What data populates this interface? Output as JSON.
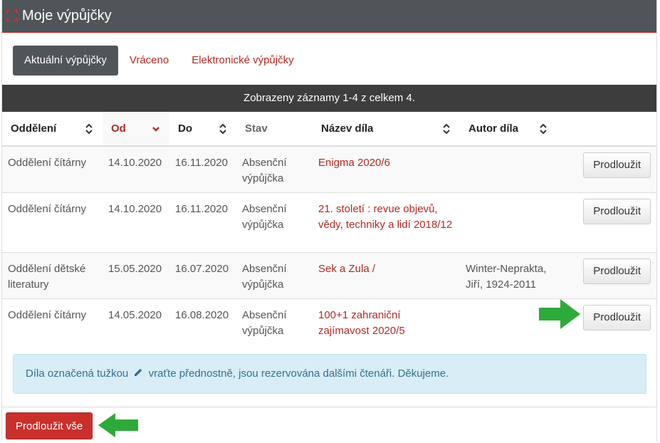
{
  "header": {
    "title": "Moje výpůjčky",
    "icon": "expand-icon"
  },
  "tabs": [
    {
      "label": "Aktuální výpůjčky",
      "active": true
    },
    {
      "label": "Vráceno",
      "active": false
    },
    {
      "label": "Elektronické výpůjčky",
      "active": false
    }
  ],
  "summary": "Zobrazeny záznamy 1-4 z celkem 4.",
  "table": {
    "columns": [
      "Oddělení",
      "Od",
      "Do",
      "Stav",
      "Název díla",
      "Autor díla"
    ],
    "rows": [
      {
        "department": "Oddělení čítárny",
        "from": "14.10.2020",
        "to": "16.11.2020",
        "status": "Absenční výpůjčka",
        "title": "Enigma 2020/6",
        "author": "",
        "action": "Prodloužit"
      },
      {
        "department": "Oddělení čítárny",
        "from": "14.10.2020",
        "to": "16.11.2020",
        "status": "Absenční výpůjčka",
        "title": "21. století : revue objevů, vědy, techniky a lidí 2018/12",
        "author": "",
        "action": "Prodloužit"
      },
      {
        "department": "Oddělení dětské literatury",
        "from": "15.05.2020",
        "to": "16.07.2020",
        "status": "Absenční výpůjčka",
        "title": "Sek a Zula /",
        "author": "Winter-Neprakta, Jiří, 1924-2011",
        "action": "Prodloužit"
      },
      {
        "department": "Oddělení čítárny",
        "from": "14.05.2020",
        "to": "16.08.2020",
        "status": "Absenční výpůjčka",
        "title": "100+1 zahraniční zajímavost 2020/5",
        "author": "",
        "action": "Prodloužit"
      }
    ]
  },
  "notice": {
    "before": "Díla označená tužkou",
    "after": "vraťte přednostně, jsou rezervována dalšími čtenáři. Děkujeme."
  },
  "footer": {
    "renew_all": "Prodloužit vše"
  },
  "colors": {
    "accent": "#b12a24",
    "header_bg": "#50555a",
    "danger": "#c9302c",
    "arrow": "#2eaa3a",
    "info_bg": "#d9edf7"
  }
}
